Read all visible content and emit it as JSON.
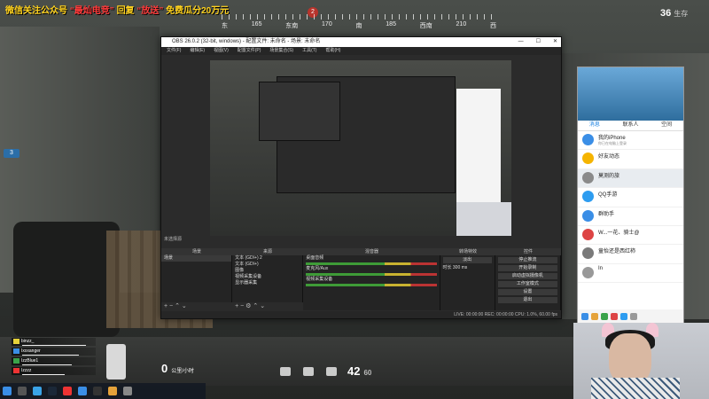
{
  "promo": {
    "prefix": "微信关注公众号",
    "account": "“最灿电竞”",
    "mid": "回复",
    "keyword": "“放送”",
    "suffix": "免费瓜分20万元"
  },
  "compass": {
    "marker": "2",
    "labels": [
      "东",
      "165",
      "东南",
      "170",
      "南",
      "185",
      "西南",
      "210",
      "西"
    ]
  },
  "alive": {
    "count": "36",
    "label": "生存"
  },
  "badge": "3",
  "obs": {
    "title": "OBS 26.0.2 (32-bit, windows) - 配置文件: 未命名 - 场景: 未命名",
    "controls": [
      "—",
      "☐",
      "✕"
    ],
    "menu": [
      "文件(F)",
      "编辑(E)",
      "视图(V)",
      "配置文件(P)",
      "场景集合(S)",
      "工具(T)",
      "帮助(H)"
    ],
    "no_source": "未选择源",
    "panel_headers": [
      "场景",
      "来源",
      "混音器",
      "转场特效",
      "控件"
    ],
    "scenes": [
      "场景"
    ],
    "sources": [
      "文本 (GDI+) 2",
      "文本 (GDI+)",
      "图像",
      "视频采集设备",
      "显示器采集"
    ],
    "mixer": [
      "桌面音频",
      "麦克风/Aux",
      "视频采集设备"
    ],
    "transition": {
      "type": "淡出",
      "duration_label": "时长",
      "duration": "300 ms"
    },
    "controls_buttons": [
      "停止推流",
      "开始录制",
      "启动虚拟摄像机",
      "工作室模式",
      "设置",
      "退出"
    ],
    "status": "LIVE: 00:00:00   REC: 00:00:00   CPU: 1.0%, 60.00 fps"
  },
  "qq": {
    "tabs": [
      "消息",
      "联系人",
      "空间"
    ],
    "items": [
      {
        "name": "我的iPhone",
        "preview": "你已在电脑上登录",
        "time": "",
        "color": "#3a8ee6"
      },
      {
        "name": "好友动态",
        "preview": "",
        "time": "",
        "color": "#f5b400"
      },
      {
        "name": "莫测的旅",
        "preview": "",
        "time": "",
        "color": "#8a8a8a"
      },
      {
        "name": "QQ手游",
        "preview": "",
        "time": "",
        "color": "#2d9cf0"
      },
      {
        "name": "群助手",
        "preview": "",
        "time": "",
        "color": "#3a8ee6"
      },
      {
        "name": "W...一花、骑士@",
        "preview": "",
        "time": "",
        "color": "#d44"
      },
      {
        "name": "童怡还是西红柿",
        "preview": "",
        "time": "",
        "color": "#7a7a7a"
      },
      {
        "name": "In",
        "preview": "",
        "time": "",
        "color": "#999"
      }
    ]
  },
  "team": [
    {
      "name": "binzz_",
      "color": "#e5d23a",
      "hp": 0.9
    },
    {
      "name": "Ixxxanger",
      "color": "#3a8ee6",
      "hp": 0.8
    },
    {
      "name": "IzzBlue1",
      "color": "#3aa34a",
      "hp": 0.7
    },
    {
      "name": "Izzzz",
      "color": "#e33",
      "hp": 0.6
    }
  ],
  "hud": {
    "fuel": "0",
    "fuel_unit": "公里/小时",
    "ammo": "42",
    "ammo_total": "60"
  },
  "colors": {
    "promo_text": "#ffd21e",
    "promo_highlight": "#ff3b3b",
    "obs_bg": "#2b2b2b",
    "qq_accent": "#1a82e2"
  }
}
